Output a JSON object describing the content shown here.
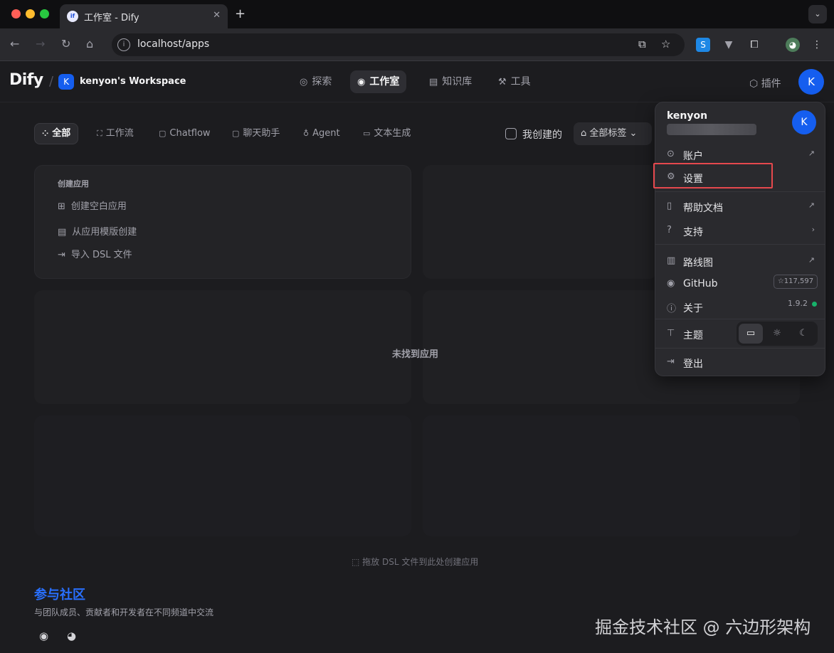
{
  "browser": {
    "tab_title": "工作室 - Dify",
    "tab_favicon": "if",
    "url": "localhost/apps",
    "new_tab": "+",
    "close": "✕",
    "tab_menu": "⌄"
  },
  "header": {
    "logo": "Dify",
    "workspace_initial": "K",
    "workspace_name": "kenyon's Workspace",
    "nav": [
      {
        "label": "探索",
        "icon": "compass-icon",
        "glyph": "◎"
      },
      {
        "label": "工作室",
        "icon": "robot-icon",
        "glyph": "◉"
      },
      {
        "label": "知识库",
        "icon": "book-icon",
        "glyph": "▤"
      },
      {
        "label": "工具",
        "icon": "hammer-icon",
        "glyph": "⚒"
      }
    ],
    "plugin": "插件",
    "user_initial": "K"
  },
  "filters": {
    "types": [
      "全部",
      "工作流",
      "Chatflow",
      "聊天助手",
      "Agent",
      "文本生成"
    ],
    "my_created": "我创建的",
    "all_tags": "全部标签"
  },
  "create": {
    "title": "创建应用",
    "items": [
      "创建空白应用",
      "从应用模版创建",
      "导入 DSL 文件"
    ]
  },
  "empty_message": "未找到应用",
  "drop_hint": "拖放 DSL 文件到此处创建应用",
  "community": {
    "title": "参与社区",
    "desc": "与团队成员、贡献者和开发者在不同频道中交流"
  },
  "watermark": "掘金技术社区 @ 六边形架构",
  "dropdown": {
    "name": "kenyon",
    "avatar_initial": "K",
    "items": {
      "account": "账户",
      "settings": "设置",
      "help": "帮助文档",
      "support": "支持",
      "roadmap": "路线图",
      "github": "GitHub",
      "about": "关于",
      "theme": "主题",
      "logout": "登出"
    },
    "github_stars": "☆117,597",
    "version": "1.9.2"
  },
  "colors": {
    "accent": "#155eef",
    "community": "#2970ff",
    "highlight": "#e5484d",
    "status": "#17b26a"
  }
}
